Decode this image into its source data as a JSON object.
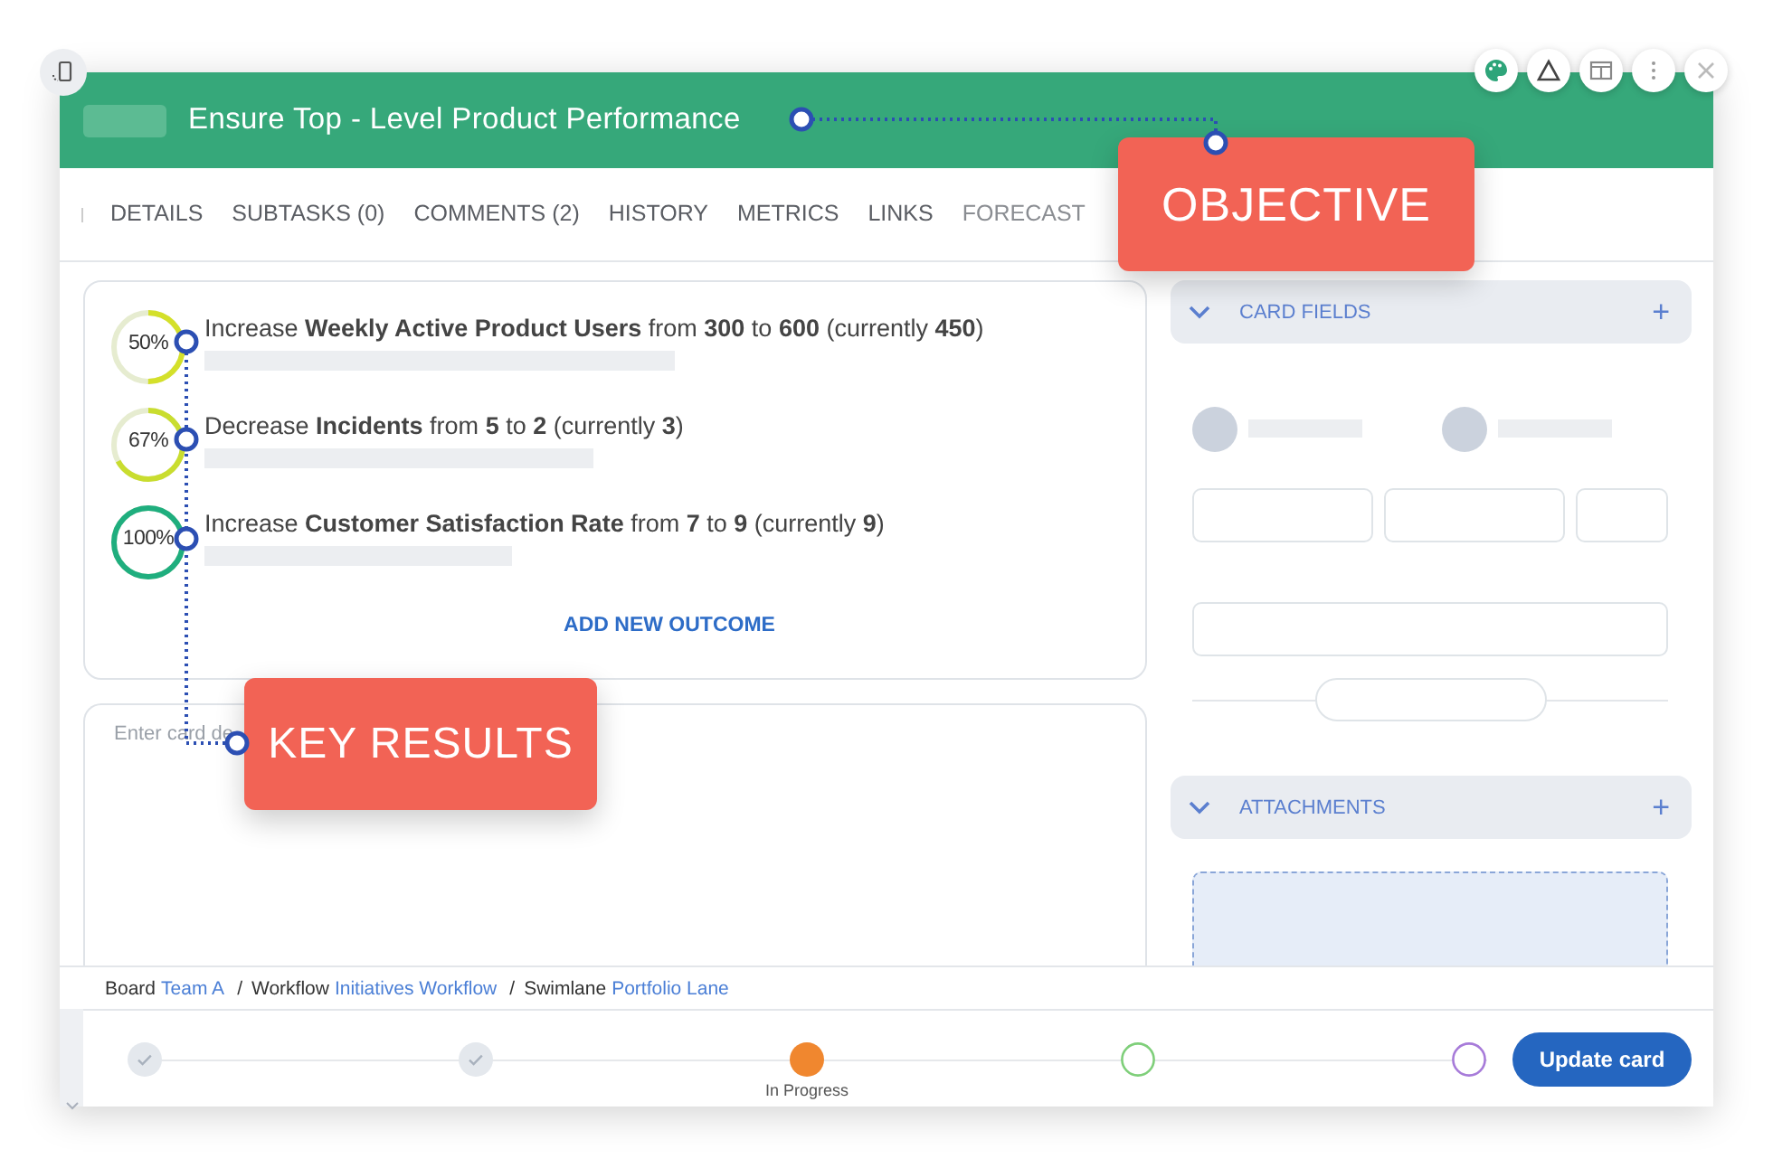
{
  "window": {
    "title": "Ensure Top - Level Product Performance"
  },
  "tabs": [
    {
      "label": "DETAILS",
      "selected": false
    },
    {
      "label": "SUBTASKS (0)",
      "selected": false
    },
    {
      "label": "COMMENTS (2)",
      "selected": false
    },
    {
      "label": "HISTORY",
      "selected": false
    },
    {
      "label": "METRICS",
      "selected": false
    },
    {
      "label": "LINKS",
      "selected": false
    },
    {
      "label": "FORECAST",
      "selected": false
    }
  ],
  "outcomes": [
    {
      "percent": "50%",
      "level": 0.5,
      "color": "#d4e02a",
      "text": "Increase **Weekly Active Product Users** from **300** to **600** (currently **450**)"
    },
    {
      "percent": "67%",
      "level": 0.67,
      "color": "#c9dd2f",
      "text": "Decrease **Incidents** from **5** to **2** (currently **3**)"
    },
    {
      "percent": "100%",
      "level": 1,
      "color": "#1fae7e",
      "text": "Increase **Customer Satisfaction Rate** from **7** to **9** (currently **9**)"
    }
  ],
  "add_outcome": "ADD NEW OUTCOME",
  "description": {
    "placeholder": "Enter card de"
  },
  "panels": [
    {
      "title": "CARD FIELDS",
      "expanded": true,
      "add": "+"
    },
    {
      "title": "ATTACHMENTS",
      "expanded": true,
      "add": "+"
    }
  ],
  "breadcrumb": {
    "separator": "/",
    "items": [
      {
        "label": "Board",
        "value": "Team A"
      },
      {
        "label": "Workflow",
        "value": "Initiatives Workflow"
      },
      {
        "label": "Swimlane",
        "value": "Portfolio Lane"
      }
    ]
  },
  "steps": [
    {
      "kind": "done"
    },
    {
      "kind": "done"
    },
    {
      "kind": "current",
      "label": "In Progress",
      "color": "#f0872f"
    },
    {
      "kind": "pending",
      "color": "#7fcf7a"
    },
    {
      "kind": "pending",
      "color": "#a77bd9"
    }
  ],
  "update_button": "Update card",
  "callouts": [
    {
      "kind": "objective",
      "label": "OBJECTIVE"
    },
    {
      "kind": "key_results",
      "label": "KEY RESULTS"
    }
  ]
}
